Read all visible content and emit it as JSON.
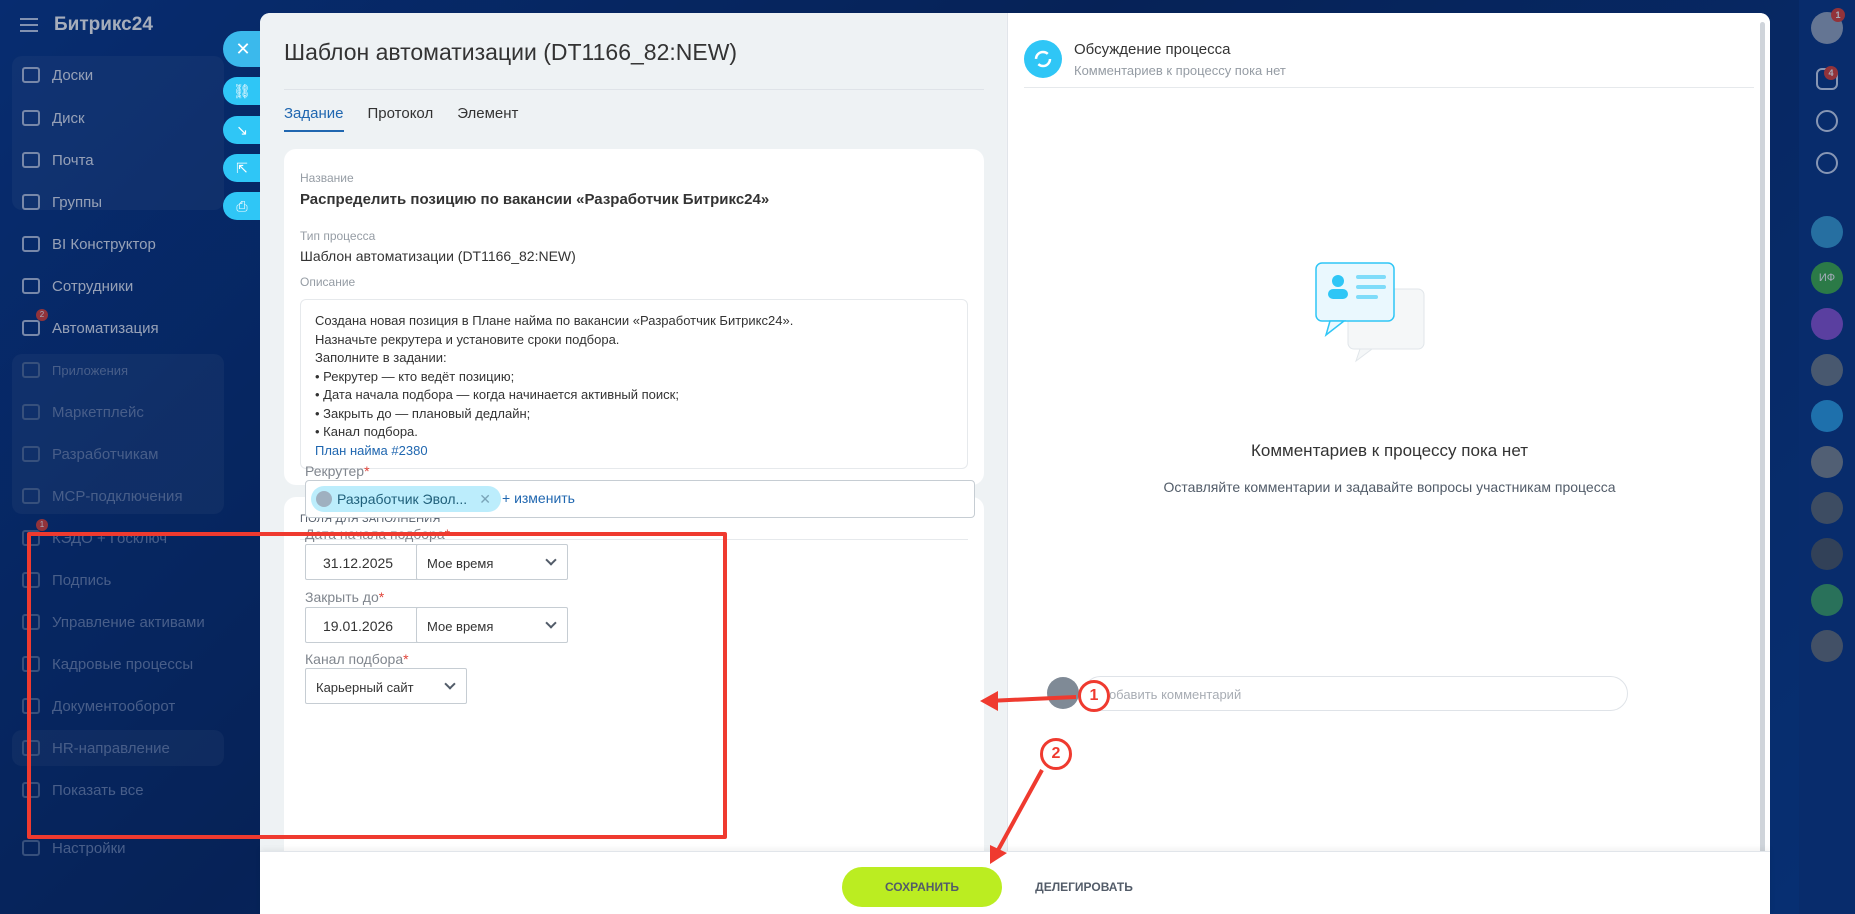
{
  "app": {
    "logo": "Битрикс24",
    "nav": [
      {
        "label": "Доски"
      },
      {
        "label": "Диск"
      },
      {
        "label": "Почта"
      },
      {
        "label": "Группы"
      },
      {
        "label": "BI Конструктор"
      },
      {
        "label": "Сотрудники"
      },
      {
        "label": "Автоматизация",
        "badge": "2"
      },
      {
        "label": "Приложения"
      },
      {
        "label": "Маркетплейс"
      },
      {
        "label": "Разработчикам"
      },
      {
        "label": "MCP-подключения"
      },
      {
        "label": "КЭДО + Госключ",
        "badge": "1"
      },
      {
        "label": "Подпись"
      },
      {
        "label": "Управление активами"
      },
      {
        "label": "Кадровые процессы"
      },
      {
        "label": "Документооборот"
      },
      {
        "label": "HR-направление"
      },
      {
        "label": "Показать все"
      },
      {
        "label": "Настройки"
      }
    ],
    "rail_badges": {
      "profile": "1",
      "notifications": "4"
    },
    "rail_avatar_text": "ИФ"
  },
  "task": {
    "title": "Шаблон автоматизации (DT1166_82:NEW)",
    "tabs": [
      "Задание",
      "Протокол",
      "Элемент"
    ],
    "name_label": "Название",
    "name_value": "Распределить позицию по вакансии «Разработчик Битрикс24»",
    "type_label": "Тип процесса",
    "type_value": "Шаблон автоматизации (DT1166_82:NEW)",
    "desc_label": "Описание",
    "desc_lines": [
      "Создана новая позиция в Плане найма по вакансии «Разработчик Битрикс24».",
      "Назначьте рекрутера и установите сроки подбора.",
      "Заполните в задании:",
      "• Рекрутер — кто ведёт позицию;",
      "• Дата начала подбора — когда начинается активный поиск;",
      "• Закрыть до — плановый дедлайн;",
      "• Канал подбора."
    ],
    "desc_link": "План найма #2380",
    "fields_header": "ПОЛЯ ДЛЯ ЗАПОЛНЕНИЯ",
    "recruiter_label": "Рекрутер",
    "recruiter_value": "Разработчик Эвол...",
    "change_link": "+ изменить",
    "start_label": "Дата начала подбора",
    "start_date": "31.12.2025",
    "start_tz": "Мое время",
    "close_label": "Закрыть до",
    "close_date": "19.01.2026",
    "close_tz": "Мое время",
    "channel_label": "Канал подбора",
    "channel_value": "Карьерный сайт",
    "required_mark": "*"
  },
  "discussion": {
    "title": "Обсуждение процесса",
    "subtitle": "Комментариев к процессу пока нет",
    "empty_title": "Комментариев к процессу пока нет",
    "empty_sub": "Оставляйте комментарии и задавайте вопросы участникам процесса",
    "comment_placeholder": "Добавить комментарий"
  },
  "footer": {
    "save": "СОХРАНИТЬ",
    "delegate": "ДЕЛЕГИРОВАТЬ"
  },
  "annotations": {
    "one": "1",
    "two": "2"
  },
  "colors": {
    "accent": "#2fc6f6",
    "link": "#2067b0",
    "save": "#bbed21",
    "highlight": "#ef3a2f"
  }
}
